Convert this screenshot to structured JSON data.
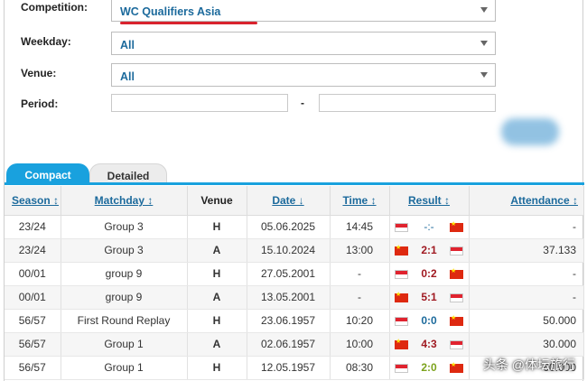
{
  "filters": {
    "competition_label": "Competition:",
    "competition_value": "WC Qualifiers Asia",
    "weekday_label": "Weekday:",
    "weekday_value": "All",
    "venue_label": "Venue:",
    "venue_value": "All",
    "period_label": "Period:",
    "period_separator": "-"
  },
  "tabs": {
    "compact": "Compact",
    "detailed": "Detailed"
  },
  "table": {
    "headers": {
      "season": "Season ↕",
      "matchday": "Matchday ↕",
      "venue": "Venue",
      "date": "Date ↓",
      "time": "Time ↕",
      "result": "Result ↕",
      "attendance": "Attendance ↕"
    },
    "rows": [
      {
        "season": "23/24",
        "matchday": "Group 3",
        "venue": "H",
        "date": "05.06.2025",
        "time": "14:45",
        "home_flag": "indonesia",
        "result": "-:-",
        "away_flag": "china",
        "attendance": "-"
      },
      {
        "season": "23/24",
        "matchday": "Group 3",
        "venue": "A",
        "date": "15.10.2024",
        "time": "13:00",
        "home_flag": "china",
        "result": "2:1",
        "away_flag": "indonesia",
        "attendance": "37.133"
      },
      {
        "season": "00/01",
        "matchday": "group 9",
        "venue": "H",
        "date": "27.05.2001",
        "time": "-",
        "home_flag": "indonesia",
        "result": "0:2",
        "away_flag": "china",
        "attendance": "-"
      },
      {
        "season": "00/01",
        "matchday": "group 9",
        "venue": "A",
        "date": "13.05.2001",
        "time": "-",
        "home_flag": "china",
        "result": "5:1",
        "away_flag": "indonesia",
        "attendance": "-"
      },
      {
        "season": "56/57",
        "matchday": "First Round Replay",
        "venue": "H",
        "date": "23.06.1957",
        "time": "10:20",
        "home_flag": "indonesia",
        "result": "0:0",
        "away_flag": "china",
        "attendance": "50.000"
      },
      {
        "season": "56/57",
        "matchday": "Group 1",
        "venue": "A",
        "date": "02.06.1957",
        "time": "10:00",
        "home_flag": "china",
        "result": "4:3",
        "away_flag": "indonesia",
        "attendance": "30.000"
      },
      {
        "season": "56/57",
        "matchday": "Group 1",
        "venue": "H",
        "date": "12.05.1957",
        "time": "08:30",
        "home_flag": "indonesia",
        "result": "2:0",
        "away_flag": "china",
        "attendance": "60.000"
      }
    ]
  },
  "watermark": "头条 @体坛旅行",
  "colors": {
    "accent": "#19a1de",
    "link": "#1c6a9c",
    "loss": "#a01a22",
    "win": "#7ca31d",
    "underline": "#d9232e"
  }
}
